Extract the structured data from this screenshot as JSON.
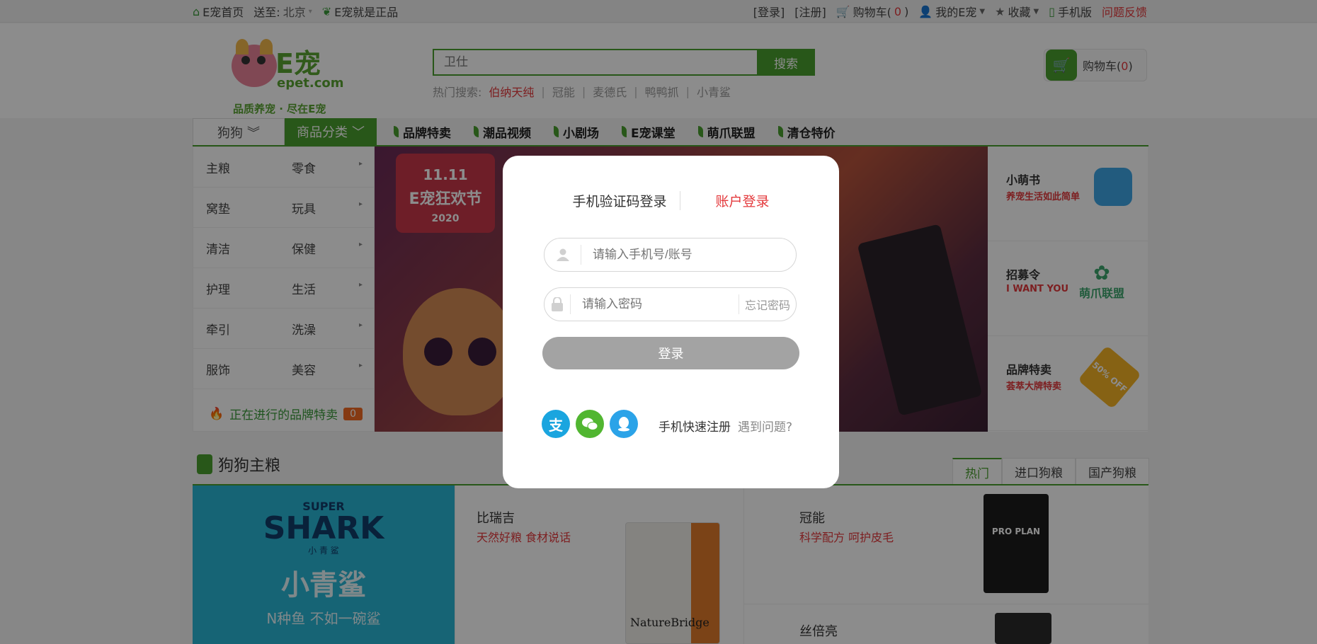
{
  "topbar": {
    "home": "E宠首页",
    "ship_label": "送至:",
    "city": "北京",
    "genuine": "E宠就是正品",
    "login": "[登录]",
    "register": "[注册]",
    "cart_label": "购物车(",
    "cart_count": "0",
    "cart_close": ")",
    "my_epet": "我的E宠",
    "favorites": "收藏",
    "mobile": "手机版",
    "feedback": "问题反馈"
  },
  "logo": {
    "brand": "E宠",
    "domain": "epet.com",
    "slogan": "品质养宠 · 尽在E宠"
  },
  "search": {
    "placeholder": "卫仕",
    "button": "搜索",
    "hot_label": "热门搜索:",
    "hot": [
      "伯纳天纯",
      "冠能",
      "麦德氏",
      "鸭鸭抓",
      "小青鲨"
    ]
  },
  "header_cart": {
    "label": "购物车(",
    "count": "0",
    "close": ")"
  },
  "nav": {
    "pet": "狗狗",
    "category": "商品分类",
    "links": [
      "品牌特卖",
      "潮品视频",
      "小剧场",
      "E宠课堂",
      "萌爪联盟",
      "清仓特价"
    ]
  },
  "sidebar": {
    "rows": [
      [
        "主粮",
        "零食"
      ],
      [
        "窝垫",
        "玩具"
      ],
      [
        "清洁",
        "保健"
      ],
      [
        "护理",
        "生活"
      ],
      [
        "牵引",
        "洗澡"
      ],
      [
        "服饰",
        "美容"
      ]
    ],
    "brand_sale": "正在进行的品牌特卖",
    "brand_sale_count": "0"
  },
  "banner": {
    "date": "11.11",
    "event": "E宠狂欢节",
    "year": "2020"
  },
  "promos": [
    {
      "title": "小萌书",
      "sub": "养宠生活如此简单"
    },
    {
      "title": "招募令",
      "sub": "I WANT YOU",
      "badge": "萌爪联盟"
    },
    {
      "title": "品牌特卖",
      "sub": "荟萃大牌特卖",
      "badge": "50% OFF"
    }
  ],
  "section": {
    "title": "狗狗主粮",
    "tabs": [
      "热门",
      "进口狗粮",
      "国产狗粮"
    ]
  },
  "ads": {
    "shark_super": "SUPER",
    "shark_brand": "SHARK",
    "shark_cn_small": "小 青 鲨",
    "shark_cn": "小青鲨",
    "shark_tag": "N种鱼 不如一碗鲨"
  },
  "products": [
    {
      "name": "比瑞吉",
      "desc": "天然好粮 食材说话",
      "pack": "NatureBridge"
    },
    {
      "name": "冠能",
      "desc": "科学配方 呵护皮毛",
      "pack": "PRO PLAN"
    },
    {
      "name": "丝倍亮",
      "desc": ""
    }
  ],
  "modal": {
    "tab_sms": "手机验证码登录",
    "tab_account": "账户登录",
    "account_placeholder": "请输入手机号/账号",
    "password_placeholder": "请输入密码",
    "forgot": "忘记密码",
    "login": "登录",
    "quick_register": "手机快速注册",
    "help": "遇到问题?"
  },
  "colors": {
    "brand_green": "#4a9f2e",
    "accent_red": "#e4393c",
    "login_disabled": "#a3a3a3",
    "alipay": "#1aa5df",
    "wechat": "#51b631",
    "qq": "#2ba3e8"
  }
}
